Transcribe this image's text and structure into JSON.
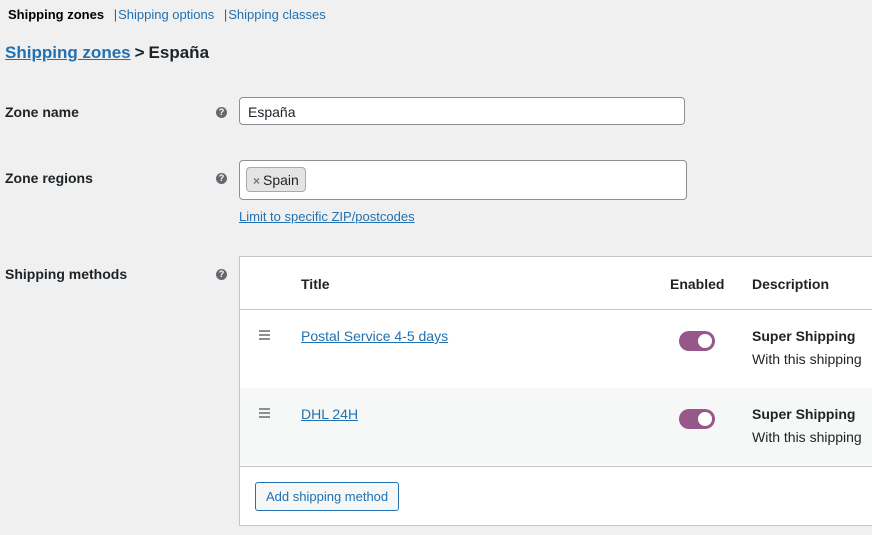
{
  "subnav": {
    "current": "Shipping zones",
    "separator": "|",
    "links": [
      "Shipping options",
      "Shipping classes"
    ]
  },
  "breadcrumb": {
    "parent": "Shipping zones",
    "separator": ">",
    "current": "España"
  },
  "help_icon_glyph": "?",
  "zone_name": {
    "label": "Zone name",
    "value": "España"
  },
  "zone_regions": {
    "label": "Zone regions",
    "remove_glyph": "×",
    "chips": [
      "Spain"
    ],
    "limit_link": "Limit to specific ZIP/postcodes"
  },
  "shipping_methods": {
    "label": "Shipping methods",
    "columns": {
      "title": "Title",
      "enabled": "Enabled",
      "description": "Description"
    },
    "rows": [
      {
        "title": "Postal Service 4-5 days",
        "enabled": true,
        "description_title": "Super Shipping",
        "description_text": "With this shipping"
      },
      {
        "title": "DHL 24H",
        "enabled": true,
        "description_title": "Super Shipping",
        "description_text": "With this shipping"
      }
    ],
    "add_button": "Add shipping method"
  },
  "colors": {
    "link": "#2271b1",
    "toggle_on": "#96588a",
    "background": "#f0f0f1"
  }
}
